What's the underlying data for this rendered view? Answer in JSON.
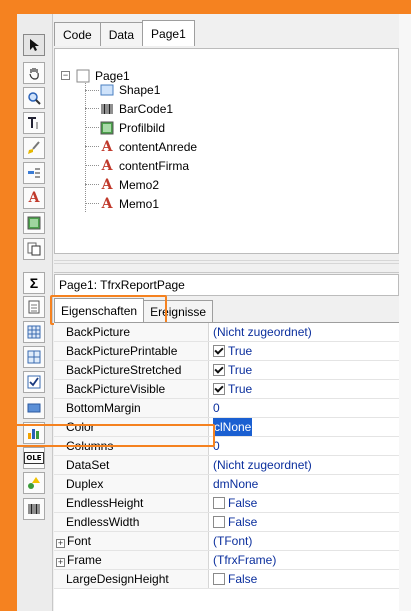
{
  "colors": {
    "accent": "#f58220",
    "value_text": "#0b2f9d",
    "selection": "#1a5fd1"
  },
  "toolbar": {
    "items": [
      {
        "name": "select-tool",
        "icon": "arrow-pointer-icon"
      },
      {
        "name": "hand-tool",
        "icon": "hand-icon"
      },
      {
        "name": "zoom-tool",
        "icon": "magnifier-icon"
      },
      {
        "name": "text-tool",
        "icon": "text-cursor-icon"
      },
      {
        "name": "format-tool",
        "icon": "brush-icon"
      },
      {
        "name": "band-tool",
        "icon": "band-icon"
      },
      {
        "name": "memo-tool",
        "icon": "letter-a-icon",
        "glyph": "A"
      },
      {
        "name": "picture-tool",
        "icon": "picture-icon"
      },
      {
        "name": "subreport-tool",
        "icon": "pages-icon"
      },
      {
        "name": "sum-tool",
        "icon": "sigma-icon",
        "glyph": "Σ"
      },
      {
        "name": "richtext-tool",
        "icon": "document-icon"
      },
      {
        "name": "shape-tool",
        "icon": "grid-icon"
      },
      {
        "name": "table-tool",
        "icon": "table-icon"
      },
      {
        "name": "checkbox-tool",
        "icon": "checkbox-icon"
      },
      {
        "name": "line-tool",
        "icon": "line-icon"
      },
      {
        "name": "chart-tool",
        "icon": "bar-chart-icon"
      },
      {
        "name": "ole-tool",
        "icon": "ole-icon",
        "glyph": "OLE"
      },
      {
        "name": "cross-tool",
        "icon": "shapes-icon"
      },
      {
        "name": "barcode-tool",
        "icon": "barcode-icon"
      }
    ]
  },
  "top_tabs": [
    "Code",
    "Data",
    "Page1"
  ],
  "tree": {
    "root": "Page1",
    "children": [
      "Shape1",
      "BarCode1",
      "Profilbild",
      "contentAnrede",
      "contentFirma",
      "Memo2",
      "Memo1"
    ]
  },
  "object_bar": {
    "label": "Page1: TfrxReportPage"
  },
  "prop_tabs": [
    "Eigenschaften",
    "Ereignisse"
  ],
  "properties": [
    {
      "name": "BackPicture",
      "value": "(Nicht zugeordnet)"
    },
    {
      "name": "BackPicturePrintable",
      "value": "True",
      "checkbox": true,
      "checked": true
    },
    {
      "name": "BackPictureStretched",
      "value": "True",
      "checkbox": true,
      "checked": true
    },
    {
      "name": "BackPictureVisible",
      "value": "True",
      "checkbox": true,
      "checked": true
    },
    {
      "name": "BottomMargin",
      "value": "0"
    },
    {
      "name": "Color",
      "value": "clNone",
      "selected": true
    },
    {
      "name": "Columns",
      "value": "0"
    },
    {
      "name": "DataSet",
      "value": "(Nicht zugeordnet)"
    },
    {
      "name": "Duplex",
      "value": "dmNone"
    },
    {
      "name": "EndlessHeight",
      "value": "False",
      "checkbox": true,
      "checked": false
    },
    {
      "name": "EndlessWidth",
      "value": "False",
      "checkbox": true,
      "checked": false
    },
    {
      "name": "Font",
      "value": "(TFont)",
      "expandable": true
    },
    {
      "name": "Frame",
      "value": "(TfrxFrame)",
      "expandable": true
    },
    {
      "name": "LargeDesignHeight",
      "value": "False",
      "checkbox": true,
      "checked": false
    }
  ]
}
